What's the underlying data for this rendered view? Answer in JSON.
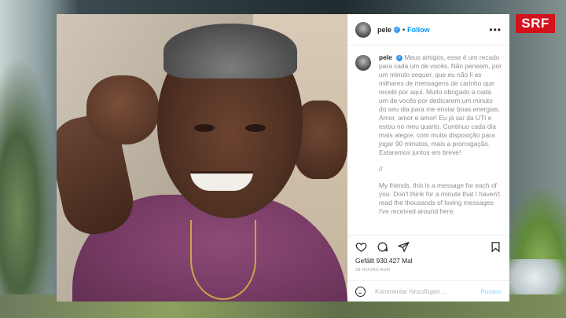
{
  "broadcaster": {
    "logo": "SRF",
    "logo_color": "#d4121c"
  },
  "post": {
    "username": "pele",
    "verified_icon": "verified-badge-icon",
    "follow_label": "Follow",
    "separator": "•",
    "more_label": "•••",
    "caption_pt": "Meus amigos, esse é um recado para cada um de vocês. Não pensem, por um minuto sequer, que eu não li as milhares de mensagens de carinho que recebi por aqui. Muito obrigado a cada um de vocês por dedicarem um minuto do seu dia para me enviar boas energias. Amor, amor e amor! Eu já saí da UTI e estou no meu quarto. Continuo cada dia mais alegre, com muita disposição para jogar 90 minutos, mais a prorrogação. Estaremos juntos em breve!",
    "caption_separator": "//",
    "caption_en": "My friends, this is a message for each of you. Don't think for a minute that I haven't read the thousands of loving messages I've received around here.",
    "likes": "Gefällt 930.427 Mal",
    "timestamp": "38 HOURS AGO",
    "comment_placeholder": "Kommentar hinzufügen ...",
    "post_label": "Posten",
    "accent_color": "#0095f6"
  }
}
